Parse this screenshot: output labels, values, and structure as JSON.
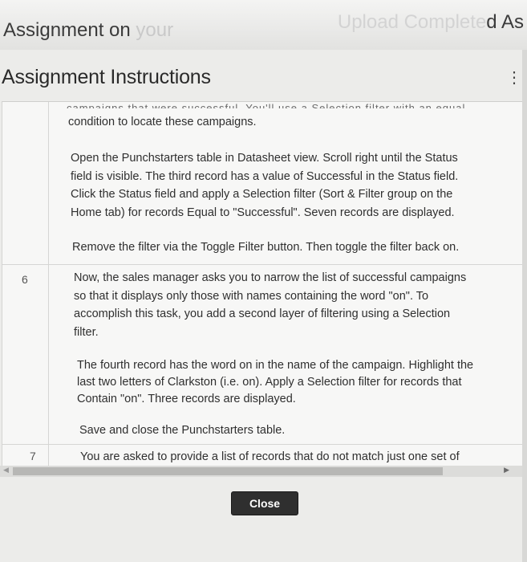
{
  "header": {
    "left_title": "Assignment on",
    "left_title_faded": " your",
    "right_title_faded": "Upload Complete",
    "right_title": "d As"
  },
  "dialog": {
    "title": "Assignment Instructions",
    "menu_icon": "vertical-ellipsis-icon",
    "cut_top_line": "campaigns that were successful. You'll use a Selection filter with an equal",
    "paragraphs": [
      {
        "lines": [
          "condition to locate these campaigns."
        ]
      },
      {
        "lines": [
          "Open the Punchstarters table in Datasheet view. Scroll right until the Status",
          "field is visible. The third record has a value of Successful in the Status field.",
          "Click the Status field and apply a Selection filter (Sort & Filter group on the",
          "Home tab) for records Equal to \"Successful\". Seven records are displayed."
        ]
      },
      {
        "lines": [
          "Remove the filter via the Toggle Filter button. Then toggle the filter back on."
        ]
      },
      {
        "lines": [
          "Now, the sales manager asks you to narrow the list of successful campaigns",
          "so that it displays only those with names containing the word \"on\". To",
          "accomplish this task, you add a second layer of filtering using a Selection",
          "filter."
        ]
      },
      {
        "lines": [
          "The fourth record has the word on in the name of the campaign. Highlight the",
          "last two letters of Clarkston (i.e. on). Apply a Selection filter for records that",
          "Contain \"on\". Three records are displayed."
        ]
      },
      {
        "lines": [
          "Save and close the Punchstarters table."
        ]
      },
      {
        "lines": [
          "You are asked to provide a list of records that do not match just one set of"
        ]
      }
    ],
    "row_numbers": [
      "6",
      "7"
    ],
    "close_label": "Close"
  },
  "colors": {
    "close_button_bg": "#2f2f2f",
    "panel_bg": "#f7f7f6",
    "dialog_bg": "#ececea"
  }
}
